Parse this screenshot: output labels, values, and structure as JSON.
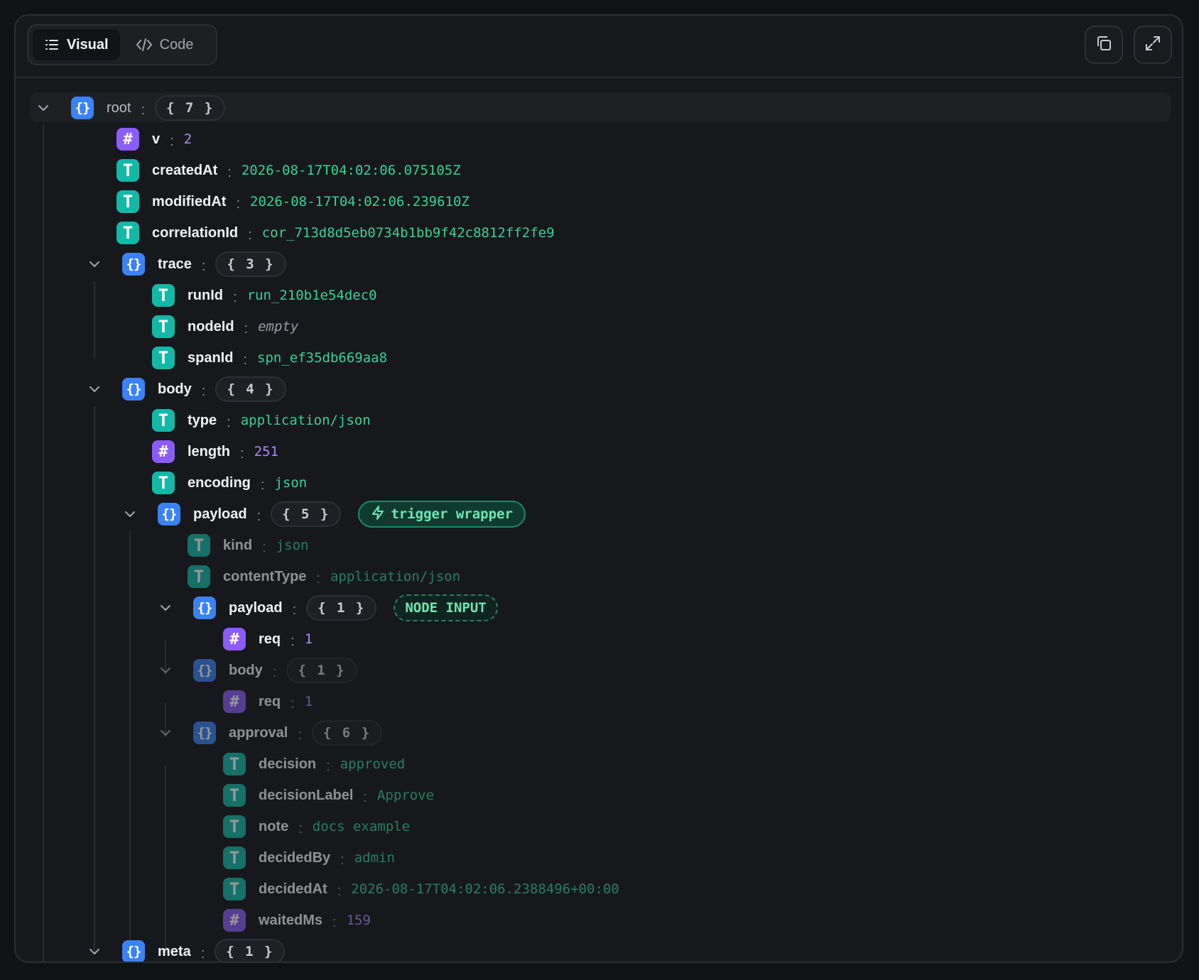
{
  "header": {
    "tabs": [
      {
        "label": "Visual",
        "active": true,
        "icon": "list-icon"
      },
      {
        "label": "Code",
        "active": false,
        "icon": "code-icon"
      }
    ],
    "actions": [
      "copy-icon",
      "expand-icon"
    ]
  },
  "colors": {
    "object": "#3b82f6",
    "string": "#14b8a6",
    "number": "#8b5cf6",
    "string_value": "#34d399",
    "number_value": "#a78bfa"
  },
  "tree": {
    "root": {
      "key": "root",
      "count": "{ 7 }"
    },
    "v": {
      "key": "v",
      "value": "2"
    },
    "createdAt": {
      "key": "createdAt",
      "value": "2026-08-17T04:02:06.075105Z"
    },
    "modifiedAt": {
      "key": "modifiedAt",
      "value": "2026-08-17T04:02:06.239610Z"
    },
    "correlationId": {
      "key": "correlationId",
      "value": "cor_713d8d5eb0734b1bb9f42c8812ff2fe9"
    },
    "trace": {
      "key": "trace",
      "count": "{ 3 }"
    },
    "runId": {
      "key": "runId",
      "value": "run_210b1e54dec0"
    },
    "nodeId": {
      "key": "nodeId",
      "value": "empty"
    },
    "spanId": {
      "key": "spanId",
      "value": "spn_ef35db669aa8"
    },
    "body": {
      "key": "body",
      "count": "{ 4 }"
    },
    "type": {
      "key": "type",
      "value": "application/json"
    },
    "length": {
      "key": "length",
      "value": "251"
    },
    "encoding": {
      "key": "encoding",
      "value": "json"
    },
    "payload": {
      "key": "payload",
      "count": "{ 5 }",
      "tag": "trigger wrapper"
    },
    "kind": {
      "key": "kind",
      "value": "json"
    },
    "contentType": {
      "key": "contentType",
      "value": "application/json"
    },
    "payload_inner": {
      "key": "payload",
      "count": "{ 1 }",
      "tag": "NODE INPUT"
    },
    "req1": {
      "key": "req",
      "value": "1"
    },
    "body_inner": {
      "key": "body",
      "count": "{ 1 }"
    },
    "req2": {
      "key": "req",
      "value": "1"
    },
    "approval": {
      "key": "approval",
      "count": "{ 6 }"
    },
    "decision": {
      "key": "decision",
      "value": "approved"
    },
    "decisionLabel": {
      "key": "decisionLabel",
      "value": "Approve"
    },
    "note": {
      "key": "note",
      "value": "docs example"
    },
    "decidedBy": {
      "key": "decidedBy",
      "value": "admin"
    },
    "decidedAt": {
      "key": "decidedAt",
      "value": "2026-08-17T04:02:06.2388496+00:00"
    },
    "waitedMs": {
      "key": "waitedMs",
      "value": "159"
    },
    "meta": {
      "key": "meta",
      "count": "{ 1 }"
    }
  }
}
